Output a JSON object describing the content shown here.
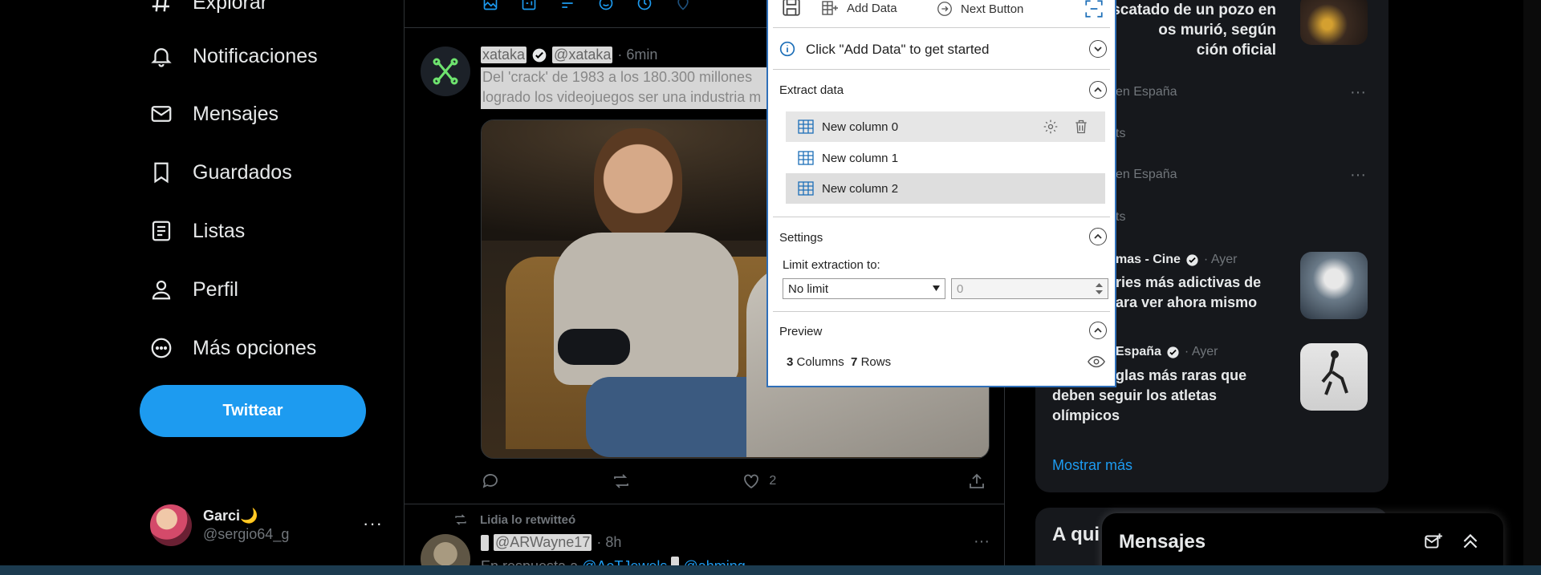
{
  "left_nav": {
    "items": [
      {
        "label": "Explorar",
        "icon": "hashtag-icon"
      },
      {
        "label": "Notificaciones",
        "icon": "bell-icon"
      },
      {
        "label": "Mensajes",
        "icon": "envelope-icon"
      },
      {
        "label": "Guardados",
        "icon": "bookmark-icon"
      },
      {
        "label": "Listas",
        "icon": "list-icon"
      },
      {
        "label": "Perfil",
        "icon": "person-icon"
      },
      {
        "label": "Más opciones",
        "icon": "more-circle-icon"
      }
    ],
    "tweet_button": "Twittear",
    "account": {
      "name": "Garci🌙",
      "handle": "@sergio64_g",
      "more": "···"
    }
  },
  "timeline": {
    "tweet1": {
      "name": "xataka",
      "handle": "@xataka",
      "time": "· 6min",
      "text_line1": "Del 'crack' de 1983 a los 180.300 millones",
      "text_line2": "logrado los videojuegos ser una industria m",
      "likes": "2"
    },
    "tweet2": {
      "retweet_label": "Lidia lo retwitteó",
      "name": "",
      "handle": "@ARWayne17",
      "time": "· 8h",
      "reply_prefix": "En respuesta a",
      "mention1": "@AoTJewels",
      "mention2": "@ahming",
      "more": "···"
    }
  },
  "trends": {
    "item1_text": [
      "scatado de un pozo en",
      "os murió, según",
      "ción oficial"
    ],
    "trend_a": {
      "context": "en España",
      "count": "ts",
      "more": "···"
    },
    "trend_b": {
      "context": "en España",
      "count": "ts",
      "more": "···"
    },
    "news2": {
      "source": "mas - Cine",
      "time": "· Ayer",
      "title_lines": [
        "ries más adictivas de",
        "ara ver ahora mismo"
      ]
    },
    "news3": {
      "source": "España",
      "time": "· Ayer",
      "title_lines": [
        "glas más raras que",
        "deben seguir los atletas",
        "olímpicos"
      ]
    },
    "show_more": "Mostrar más",
    "who_to_follow": "A qui"
  },
  "messages_dock": {
    "title": "Mensajes"
  },
  "extraction_panel": {
    "toolbar": {
      "add_data": "Add Data",
      "next_button": "Next Button"
    },
    "hint": "Click \"Add Data\" to get started",
    "extract_title": "Extract data",
    "columns": [
      "New column 0",
      "New column 1",
      "New column 2"
    ],
    "settings_title": "Settings",
    "limit_label": "Limit extraction to:",
    "limit_select": "No limit",
    "limit_value": "0",
    "preview_title": "Preview",
    "preview_columns": "3",
    "preview_columns_label": "Columns",
    "preview_rows": "7",
    "preview_rows_label": "Rows"
  },
  "colors": {
    "accent": "#1d9bf0",
    "background": "#000000",
    "panel_border": "#2f6fb8",
    "muted": "#71767b"
  }
}
